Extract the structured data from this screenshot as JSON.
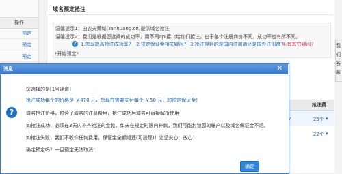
{
  "left": {
    "header": "操作",
    "links": [
      "预定",
      "预定",
      "预定",
      "预定"
    ]
  },
  "main": {
    "title": "域名预定抢注",
    "tip1": "温馨提示1：由农夫黄域(Yanhuang.cn)提供域名抢注",
    "tip2": "温馨提示2：我们是根据您选择的成功率，用不同api接口给你们抢注，由于各个注册商价不同，成功率也有所不同。",
    "faq": [
      "1.怎么提高抢注成功率？",
      "2.预定保证金相关疑问？",
      "3.抢注得到的是国内注册商还是国外注册商？",
      "4.有其它疑问？"
    ],
    "start_label": "*开始预定*",
    "table_header": "抢注费",
    "rows": [
      "25个",
      "22个"
    ]
  },
  "right_tab": [
    "我",
    "们",
    "客",
    "服"
  ],
  "dialog": {
    "title": "消息",
    "close": "✕",
    "lines": [
      "您选择的是[1号通道]",
      "抢注成功每个的价格是 ￥470 元，您现在需要支付每个 ￥50 元，的预定保证金！",
      "域名抢注价格，包含了域名的注册费用，抢注成功后域名可直接解析使用",
      "如抢注成功，必须在3天内补齐抢注的金款，如未在规定时限内补款，我们可能封锁您的帐户以及域名保证金不退。",
      "如抢注失败，我们不收你任何费用，保证金全额退还(可提现)！让您安心、放心！",
      "确定预定吗？一旦预定无法取消！"
    ],
    "ok_label": "确定"
  },
  "colors": {
    "dialog_header": "#3877c9",
    "link": "#1a66b8",
    "accent_red": "#d9304a"
  }
}
